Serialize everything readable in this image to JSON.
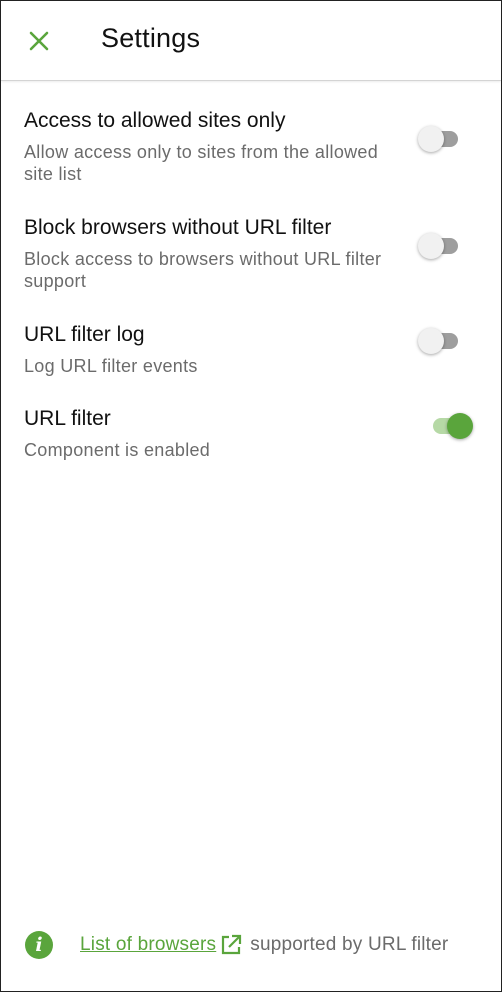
{
  "header": {
    "title": "Settings"
  },
  "settings": [
    {
      "label": "Access to allowed sites only",
      "description": "Allow access only to sites from the allowed site list",
      "enabled": false
    },
    {
      "label": "Block browsers without URL filter",
      "description": "Block access to browsers without URL filter support",
      "enabled": false
    },
    {
      "label": "URL filter log",
      "description": "Log URL filter events",
      "enabled": false
    },
    {
      "label": "URL filter",
      "description": "Component is enabled",
      "enabled": true
    }
  ],
  "footer": {
    "link_text": "List of browsers",
    "suffix_text": "supported by URL filter"
  },
  "colors": {
    "accent": "#5aa53c",
    "switch_off": "#9e9e9e",
    "text_secondary": "#6b6b6b"
  },
  "icons": {
    "close": "close-icon",
    "info": "info-icon",
    "external_link": "external-link-icon"
  }
}
